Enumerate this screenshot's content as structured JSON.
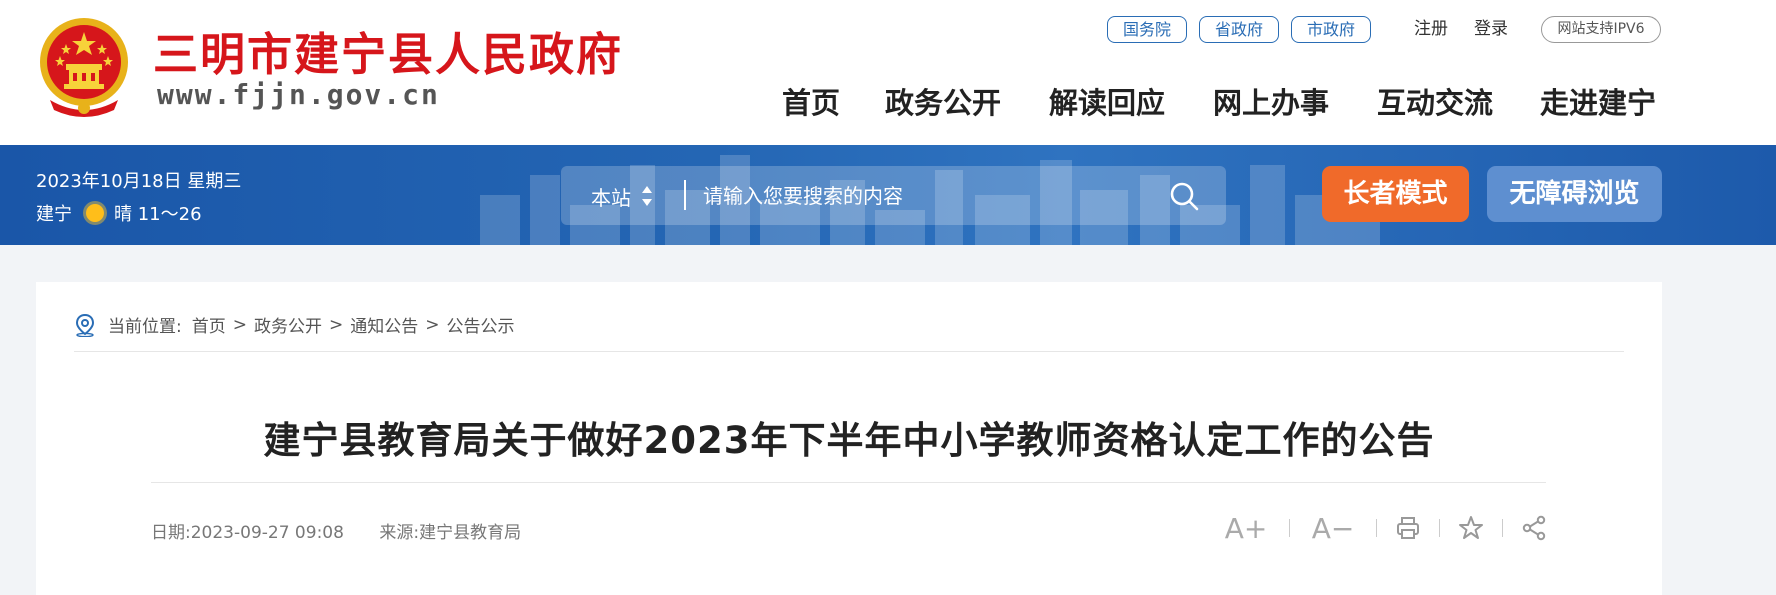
{
  "header": {
    "site_title": "三明市建宁县人民政府",
    "site_url": "www.fjjn.gov.cn",
    "top_links": [
      "国务院",
      "省政府",
      "市政府"
    ],
    "register": "注册",
    "login": "登录",
    "ipv6": "网站支持IPV6",
    "nav": [
      "首页",
      "政务公开",
      "解读回应",
      "网上办事",
      "互动交流",
      "走进建宁"
    ]
  },
  "banner": {
    "date": "2023年10月18日 星期三",
    "city": "建宁",
    "weather": "晴 11～26",
    "search_scope": "本站",
    "search_placeholder": "请输入您要搜索的内容",
    "elder_mode": "长者模式",
    "accessible": "无障碍浏览"
  },
  "breadcrumb": {
    "label": "当前位置:",
    "items": [
      "首页",
      "政务公开",
      "通知公告",
      "公告公示"
    ],
    "separator": ">"
  },
  "article": {
    "title": "建宁县教育局关于做好2023年下半年中小学教师资格认定工作的公告",
    "date_label": "日期:",
    "date": "2023-09-27 09:08",
    "source_label": "来源:",
    "source": "建宁县教育局"
  },
  "tools": {
    "font_up": "A+",
    "font_down": "A−",
    "icons": [
      "print-icon",
      "star-icon",
      "share-icon"
    ]
  },
  "colors": {
    "brand_red": "#d6161b",
    "banner_blue": "#1f5fb0",
    "elder_orange": "#f06a2a",
    "access_blue": "#5e8fd0"
  }
}
